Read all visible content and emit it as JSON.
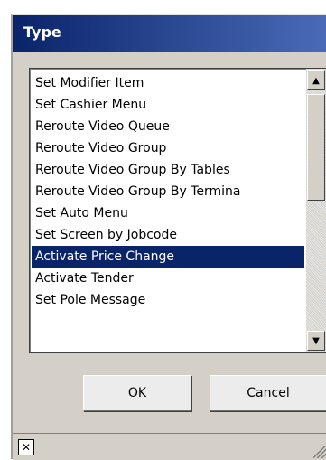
{
  "dialog": {
    "title": "Type",
    "list": {
      "items": [
        "Set Modifier Item",
        "Set Cashier Menu",
        "Reroute Video Queue",
        "Reroute Video Group",
        "Reroute Video Group By Tables",
        "Reroute Video Group By Termina",
        "Set Auto Menu",
        "Set Screen by Jobcode",
        "Activate Price Change",
        "Activate Tender",
        "Set Pole Message"
      ],
      "selected": "Activate Price Change"
    },
    "buttons": {
      "ok": "OK",
      "cancel": "Cancel"
    },
    "icons": {
      "scroll_up": "triangle-up-icon",
      "scroll_down": "triangle-down-icon",
      "close": "close-icon",
      "resize": "resize-grip-icon"
    },
    "colors": {
      "titlebar": "#0a246a",
      "selection": "#0a246a",
      "face": "#d4d0c8"
    }
  }
}
